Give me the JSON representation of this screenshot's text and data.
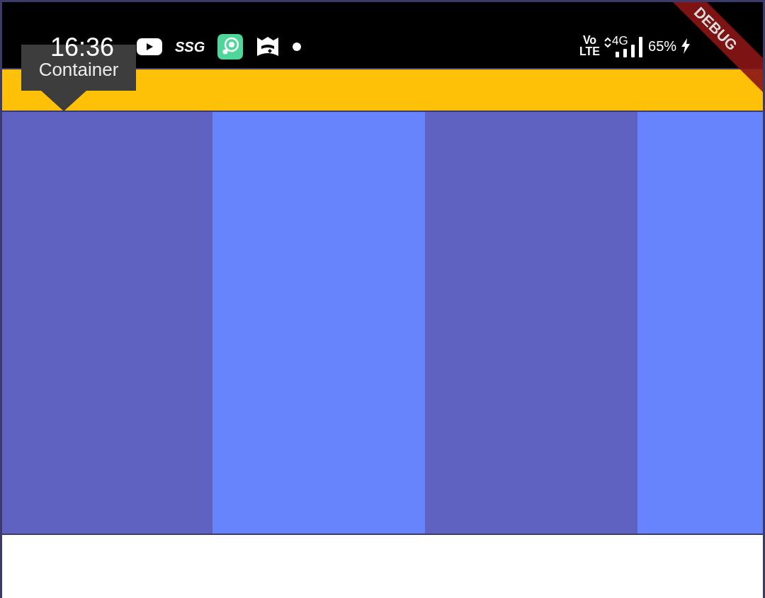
{
  "status_bar": {
    "time": "16:36",
    "app_label": "SSG",
    "volte_top": "Vo",
    "volte_bottom": "LTE",
    "network": "4G",
    "battery": "65%"
  },
  "tooltip": {
    "text": "Container"
  },
  "debug_banner": {
    "text": "DEBUG"
  },
  "columns": [
    {
      "color": "#5f62c0"
    },
    {
      "color": "#6884fc"
    },
    {
      "color": "#5f62c0"
    },
    {
      "color": "#6884fc"
    }
  ]
}
